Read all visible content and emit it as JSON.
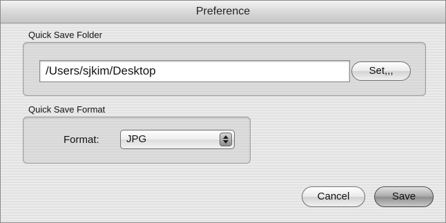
{
  "window": {
    "title": "Preference"
  },
  "quick_save_folder": {
    "label": "Quick Save Folder",
    "path_value": "/Users/sjkim/Desktop",
    "set_button_label": "Set,,,"
  },
  "quick_save_format": {
    "label": "Quick Save Format",
    "format_label": "Format:",
    "format_value": "JPG"
  },
  "buttons": {
    "cancel_label": "Cancel",
    "save_label": "Save"
  },
  "icons": {
    "select_arrows": "updown-arrows-icon"
  }
}
